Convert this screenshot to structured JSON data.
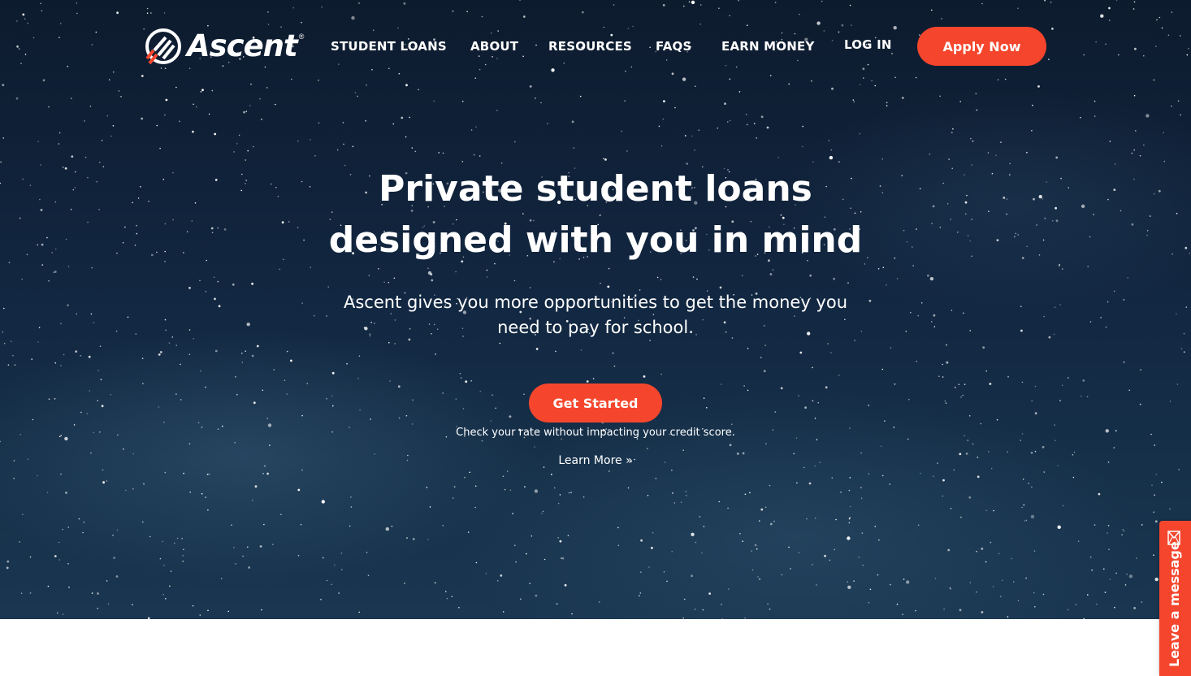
{
  "brand": {
    "name": "Ascent",
    "registered_mark": "®",
    "accent_color": "#f5462d"
  },
  "nav": {
    "items": [
      {
        "label": "STUDENT LOANS"
      },
      {
        "label": "ABOUT"
      },
      {
        "label": "RESOURCES"
      },
      {
        "label": "FAQS"
      },
      {
        "label": "EARN MONEY"
      },
      {
        "label": "LOG IN"
      }
    ],
    "apply_label": "Apply Now"
  },
  "hero": {
    "headline_line1": "Private student loans",
    "headline_line2": "designed with you in mind",
    "subhead": "Ascent gives you more opportunities to get the money you need to pay for school.",
    "cta_label": "Get Started",
    "note": "Check your rate without impacting your credit score.",
    "learn_more": "Learn More »"
  },
  "chat": {
    "label": "Leave a message",
    "icon": "mail-icon"
  }
}
